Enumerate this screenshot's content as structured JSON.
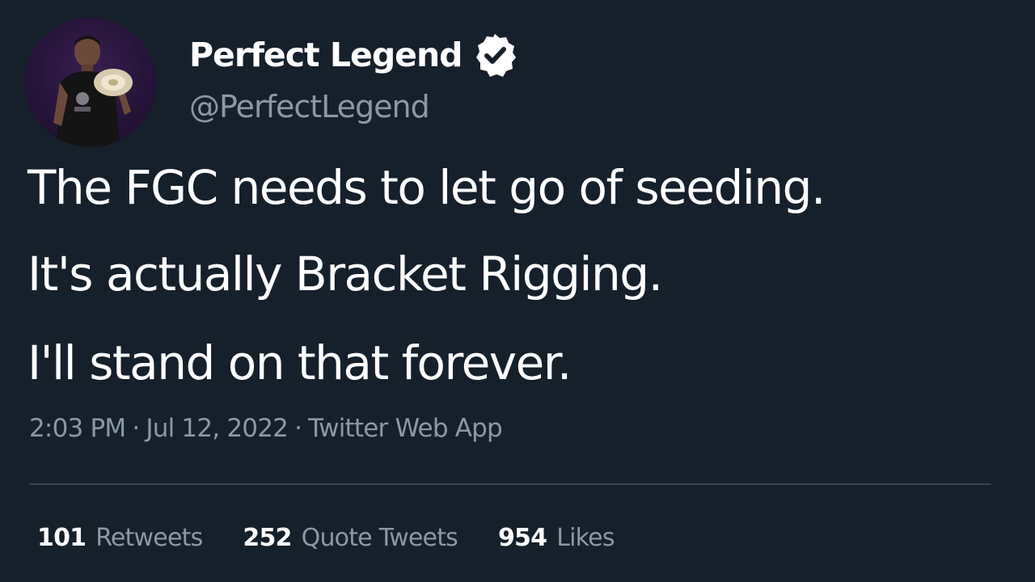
{
  "author": {
    "display_name": "Perfect Legend",
    "handle": "@PerfectLegend",
    "verified_icon": "verified-badge-icon",
    "avatar": "avatar-photo"
  },
  "tweet": {
    "lines": [
      "The FGC needs to let go of seeding.",
      "It's actually Bracket Rigging.",
      "I'll stand on that forever."
    ],
    "time": "2:03 PM",
    "date": "Jul 12, 2022",
    "source": "Twitter Web App",
    "separator": "·"
  },
  "stats": {
    "retweets": {
      "count": "101",
      "label": "Retweets"
    },
    "quote_tweets": {
      "count": "252",
      "label": "Quote Tweets"
    },
    "likes": {
      "count": "954",
      "label": "Likes"
    }
  },
  "colors": {
    "background": "#15202b",
    "primary_text": "#ffffff",
    "secondary_text": "#8b98a5",
    "divider": "#38444d"
  }
}
